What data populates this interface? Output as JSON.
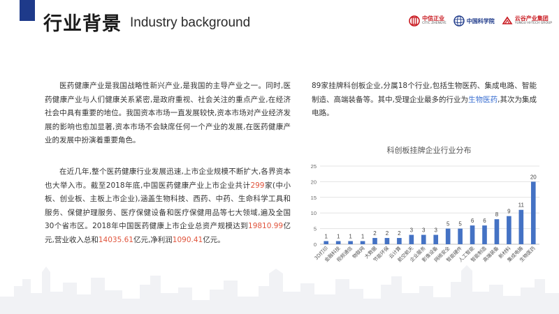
{
  "header": {
    "title_cn": "行业背景",
    "title_en": "Industry background"
  },
  "logos": [
    {
      "name": "中信正业",
      "sub": "CITIC ZHENGYE"
    },
    {
      "name": "中国科学院"
    },
    {
      "name": "云谷产业集团",
      "sub": "YUNGU HI-TECH GROUP"
    }
  ],
  "paragraphs": {
    "p1": "医药健康产业是我国战略性新兴产业,是我国的主导产业之一。同时,医药健康产业与人们健康关系紧密,是政府重视、社会关注的重点产业,在经济社会中具有重要的地位。我国资本市场一直发展较快,资本市场对产业经济发展的影响也愈加显著,资本市场不会缺席任何一个产业的发展,在医药健康产业的发展中扮演着重要角色。",
    "p2": {
      "t1": "在近几年,整个医药健康行业发展迅速,上市企业规模不断扩大,各界资本也大举入市。截至2018年底,中国医药健康产业上市企业共计",
      "h1": "299",
      "t2": "家(中小板、创业板、主板上市企业),涵盖生物科技、西药、中药、生命科学工具和服务、保健护理服务、医疗保健设备和医疗保健用品等七大领域,遍及全国30个省市区。2018年中国医药健康上市企业总资产规模达到",
      "h2": "19810.99",
      "t3": "亿元,营业收入总和",
      "h3": "14035.61",
      "t4": "亿元,净利润",
      "h4": "1090.41",
      "t5": "亿元。"
    },
    "p3": {
      "t1": "89家挂牌科创板企业,分属18个行业,包括生物医药、集成电路、智能制造、高端装备等。其中,受理企业最多的行业为",
      "h1": "生物医药",
      "t2": ",其次为集成电路。"
    }
  },
  "colors": {
    "accent_blue": "#1e3a8a",
    "bar": "#4472c4",
    "highlight_red": "#e0543c",
    "highlight_blue": "#3b6fd1"
  },
  "chart_data": {
    "type": "bar",
    "title": "科创板挂牌企业行业分布",
    "categories": [
      "3D打印",
      "金融科技",
      "视频通信",
      "物联网",
      "大数据",
      "节能环保",
      "云计算",
      "航空航天",
      "企业服务",
      "影像设备",
      "网络安全",
      "智能硬件",
      "人工智能",
      "智能制造",
      "高端装备",
      "新材料",
      "集成电路",
      "生物医药"
    ],
    "values": [
      1,
      1,
      1,
      1,
      2,
      2,
      2,
      3,
      3,
      3,
      5,
      5,
      6,
      6,
      8,
      9,
      11,
      20
    ],
    "ylim": [
      0,
      25
    ],
    "yticks": [
      0,
      5,
      10,
      15,
      20,
      25
    ],
    "grid": true
  }
}
